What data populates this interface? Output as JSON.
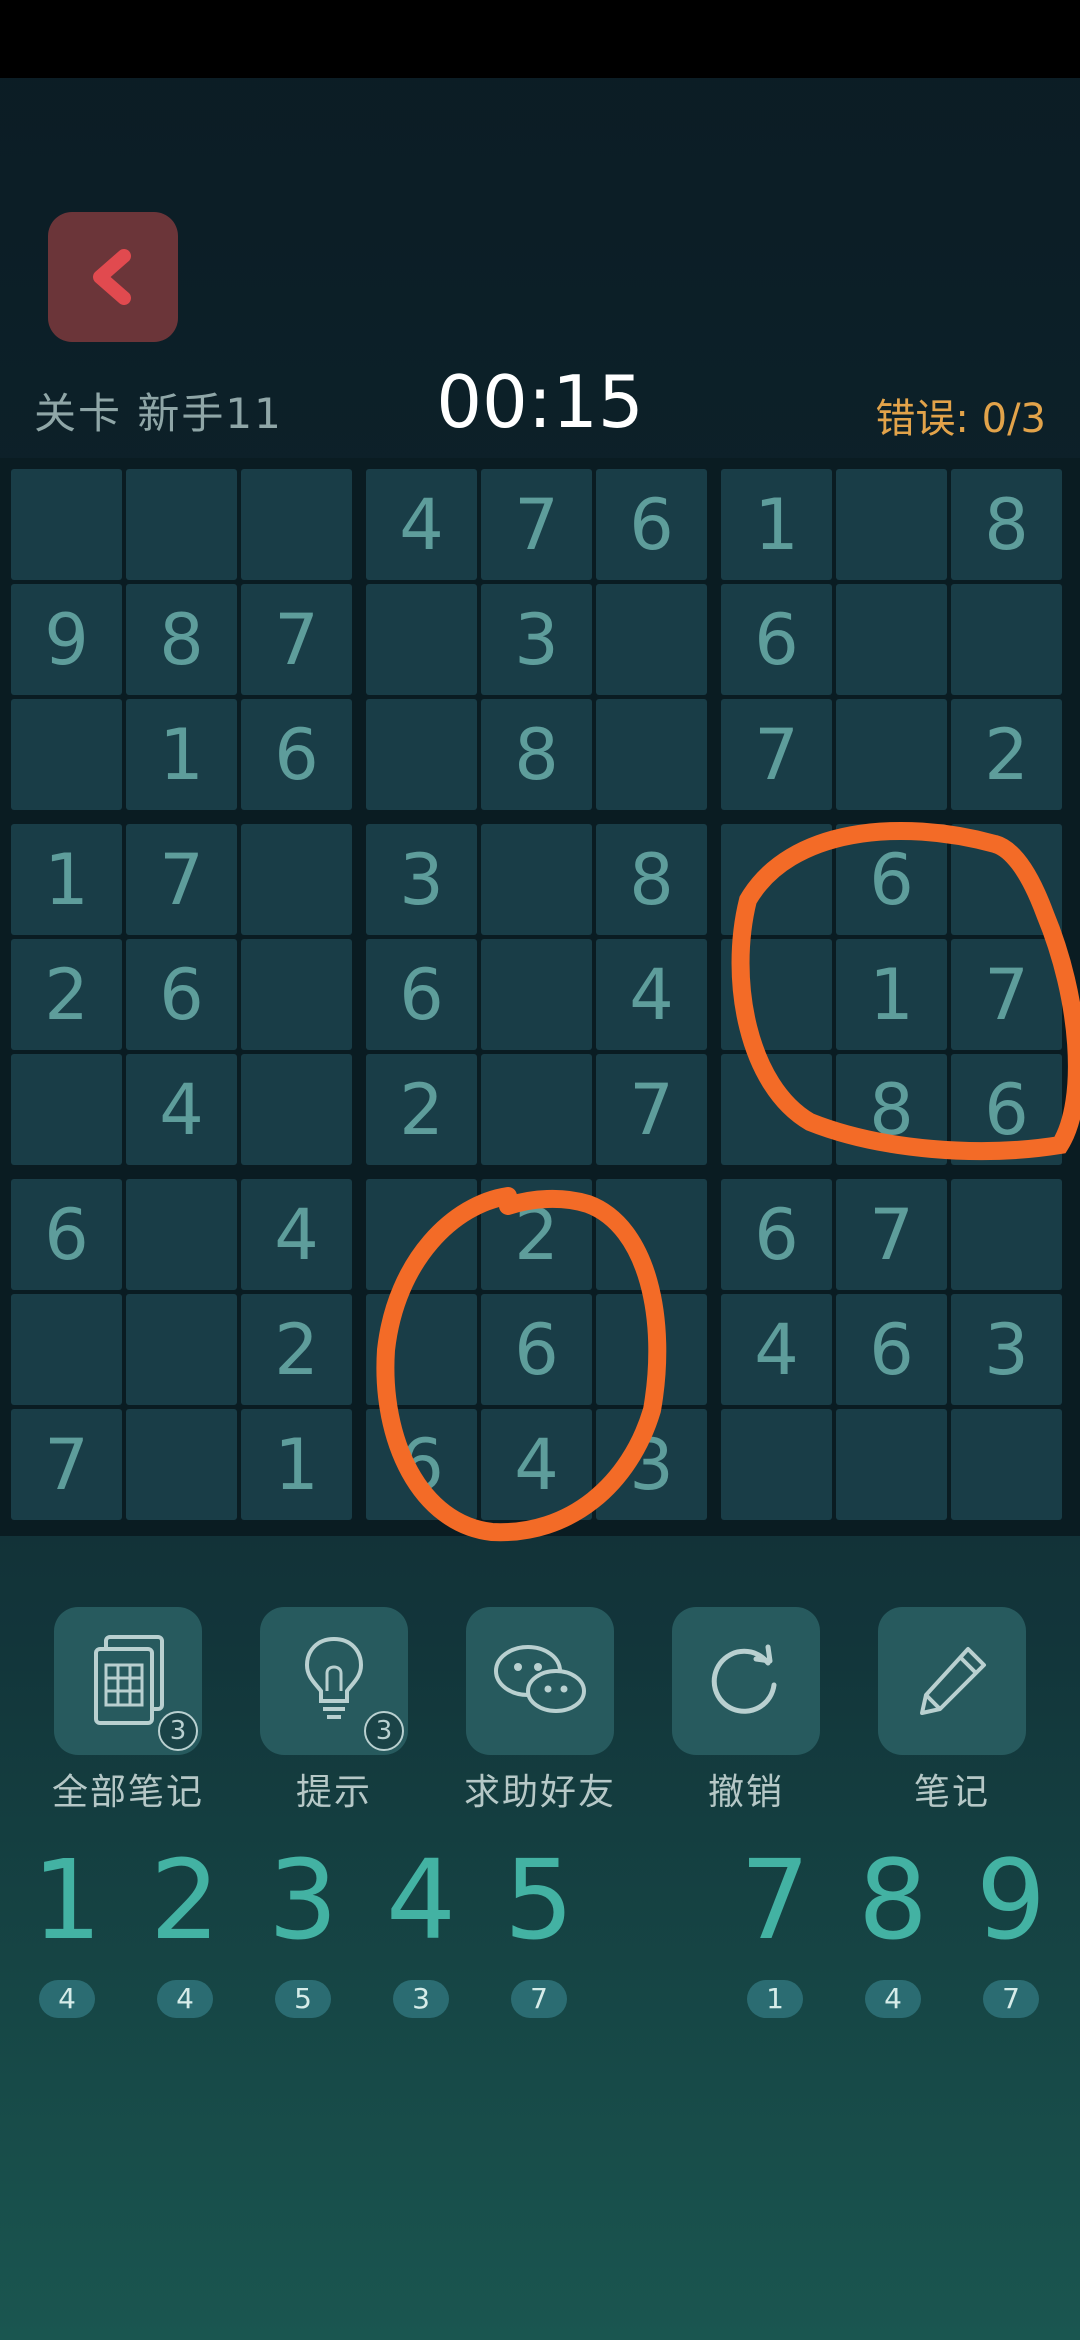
{
  "header": {
    "level": "关卡 新手11",
    "timer": "00:15",
    "mistakes_label": "错误:",
    "mistakes_value": "0/3"
  },
  "board": {
    "rows": [
      [
        "",
        "",
        "",
        "4",
        "7",
        "6",
        "1",
        "",
        "8"
      ],
      [
        "9",
        "8",
        "7",
        "",
        "3",
        "",
        "6",
        "",
        ""
      ],
      [
        "",
        "1",
        "6",
        "",
        "8",
        "",
        "7",
        "",
        "2"
      ],
      [
        "1",
        "7",
        "",
        "3",
        "",
        "8",
        "",
        "6",
        ""
      ],
      [
        "2",
        "6",
        "",
        "6",
        "",
        "4",
        "",
        "1",
        "7"
      ],
      [
        "",
        "4",
        "",
        "2",
        "",
        "7",
        "",
        "8",
        "6"
      ],
      [
        "6",
        "",
        "4",
        "",
        "2",
        "",
        "6",
        "7",
        ""
      ],
      [
        "",
        "",
        "2",
        "",
        "6",
        "",
        "4",
        "6",
        "3"
      ],
      [
        "7",
        "",
        "1",
        "6",
        "4",
        "3",
        "",
        "",
        ""
      ]
    ]
  },
  "tools": [
    {
      "name": "notes-all",
      "label": "全部笔记",
      "icon": "document-grid-icon",
      "badge": "3"
    },
    {
      "name": "hint",
      "label": "提示",
      "icon": "lightbulb-icon",
      "badge": "3"
    },
    {
      "name": "ask-friend",
      "label": "求助好友",
      "icon": "wechat-icon",
      "badge": ""
    },
    {
      "name": "undo",
      "label": "撤销",
      "icon": "undo-icon",
      "badge": ""
    },
    {
      "name": "notes",
      "label": "笔记",
      "icon": "pencil-icon",
      "badge": ""
    }
  ],
  "number_pad": [
    {
      "digit": "1",
      "count": "4"
    },
    {
      "digit": "2",
      "count": "4"
    },
    {
      "digit": "3",
      "count": "5"
    },
    {
      "digit": "4",
      "count": "3"
    },
    {
      "digit": "5",
      "count": "7"
    },
    {
      "digit": "7",
      "count": "1"
    },
    {
      "digit": "8",
      "count": "4"
    },
    {
      "digit": "9",
      "count": "7"
    }
  ],
  "colors": {
    "accent": "#43b2a3",
    "annotation": "#f36b27",
    "mistakes": "#e2a34a",
    "back_button": "#6b3539"
  }
}
